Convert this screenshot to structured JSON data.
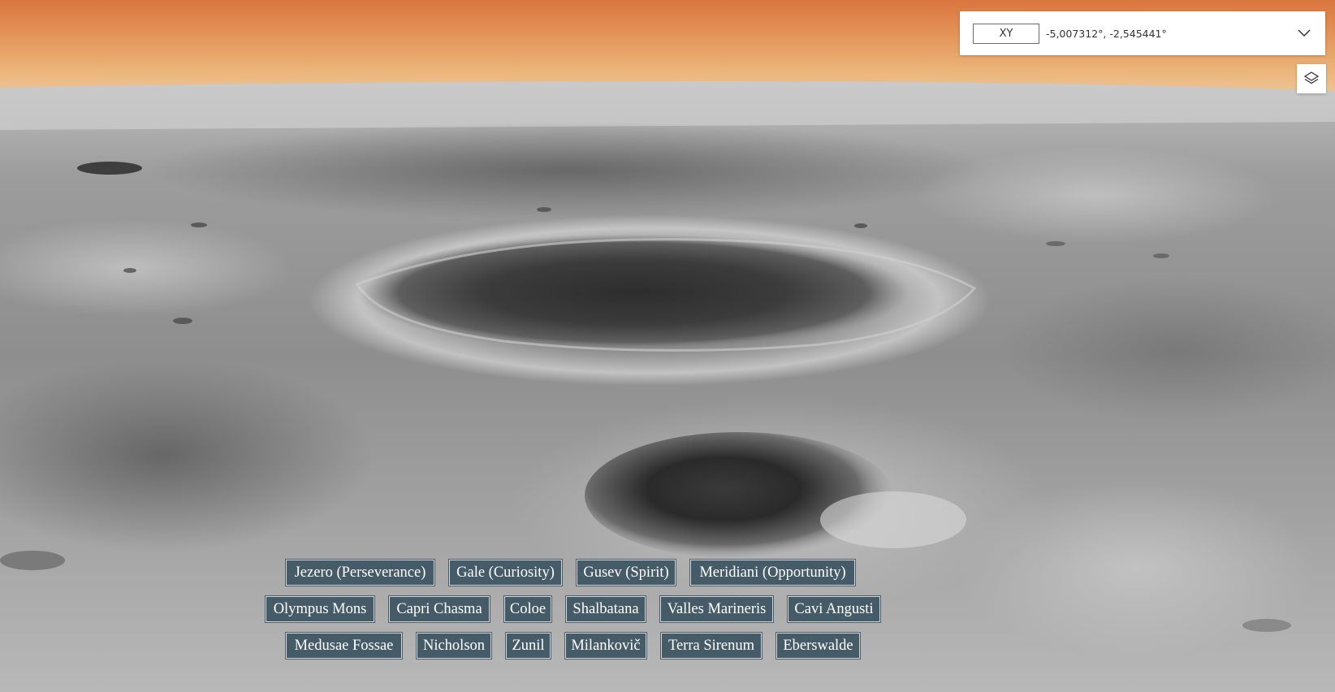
{
  "coordinates": {
    "mode_label": "XY",
    "value": "-5,007312°, -2,545441°",
    "dropdown_icon": "chevron-down-icon"
  },
  "layers": {
    "icon": "layers-icon"
  },
  "locations": {
    "row1": [
      "Jezero (Perseverance)",
      "Gale (Curiosity)",
      "Gusev (Spirit)",
      "Meridiani (Opportunity)"
    ],
    "row2": [
      "Olympus Mons",
      "Capri Chasma",
      "Coloe",
      "Shalbatana",
      "Valles Marineris",
      "Cavi Angusti"
    ],
    "row3": [
      "Medusae Fossae",
      "Nicholson",
      "Zunil",
      "Milankovič",
      "Terra Sirenum",
      "Eberswalde"
    ]
  },
  "colors": {
    "sky_top": "#d9753e",
    "sky_bottom": "#ecc596",
    "button_bg": "#465b68",
    "button_text": "#ffffff"
  }
}
